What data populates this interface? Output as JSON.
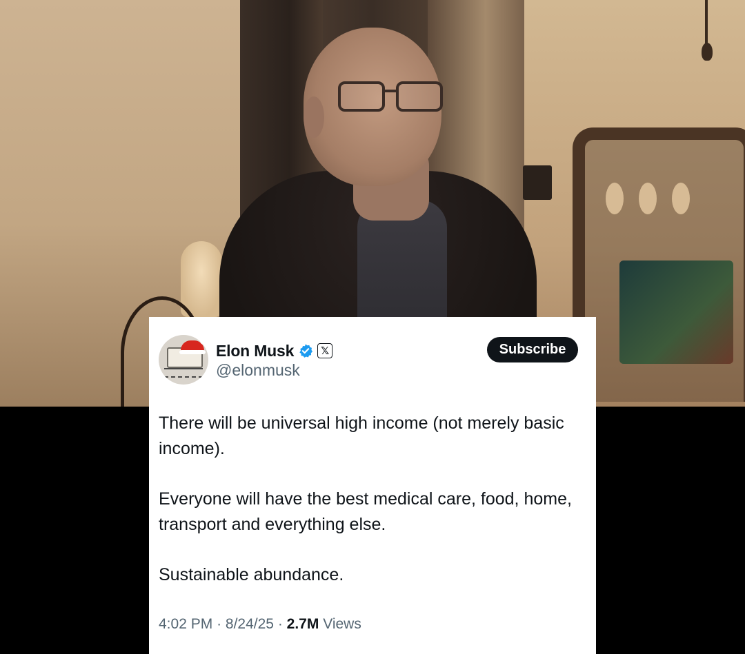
{
  "tweet": {
    "author": {
      "display_name": "Elon Musk",
      "handle": "@elonmusk",
      "verified": true,
      "affiliation_badge": "𝕏"
    },
    "subscribe_label": "Subscribe",
    "body": [
      "There will be universal high income (not merely basic income).",
      "Everyone will have the best medical care, food, home, transport and everything else.",
      "Sustainable abundance."
    ],
    "time": "4:02 PM",
    "date": "8/24/25",
    "views_count": "2.7M",
    "views_label": "Views",
    "separator": "·"
  },
  "colors": {
    "verified_blue": "#1d9bf0",
    "text_primary": "#0f1419",
    "text_secondary": "#536471",
    "button_bg": "#0f1419"
  },
  "icons": {
    "verified": "verified-badge-icon",
    "affiliation": "x-logo-icon"
  }
}
